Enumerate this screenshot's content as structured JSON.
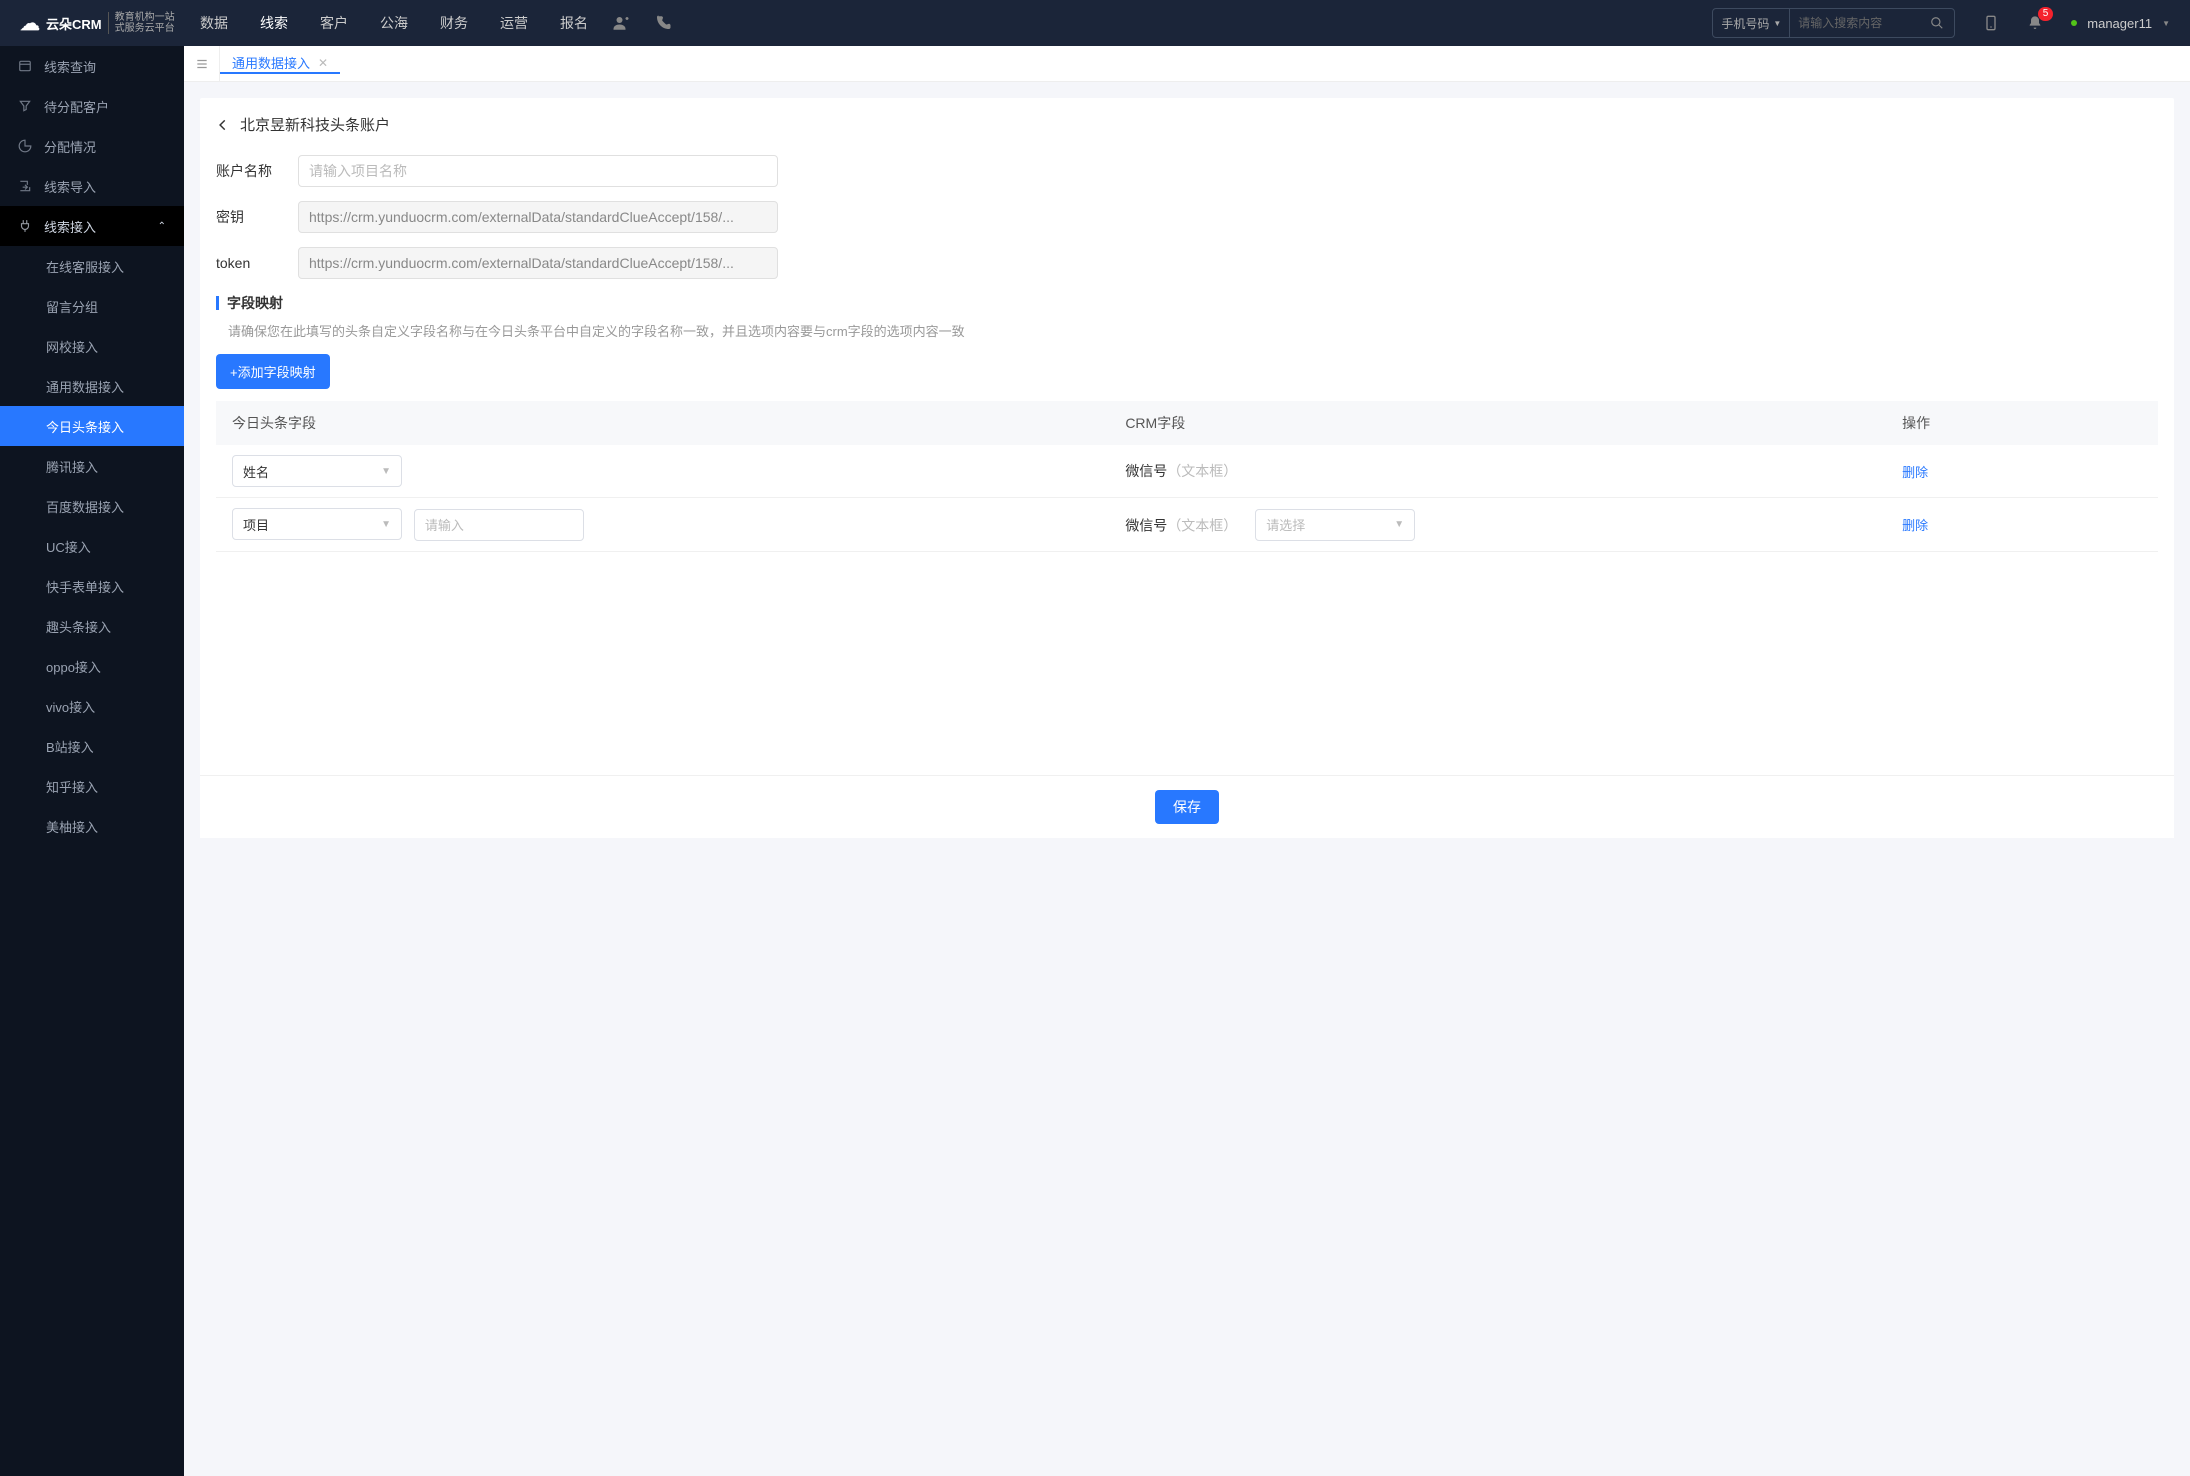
{
  "header": {
    "logo_brand": "云朵CRM",
    "logo_sub1": "教育机构一站",
    "logo_sub2": "式服务云平台",
    "nav": [
      "数据",
      "线索",
      "客户",
      "公海",
      "财务",
      "运营",
      "报名"
    ],
    "nav_active_index": 1,
    "search_type": "手机号码",
    "search_placeholder": "请输入搜索内容",
    "badge_count": "5",
    "username": "manager11"
  },
  "sidebar": {
    "items": [
      {
        "icon": "list",
        "label": "线索查询"
      },
      {
        "icon": "filter",
        "label": "待分配客户"
      },
      {
        "icon": "pie",
        "label": "分配情况"
      },
      {
        "icon": "import",
        "label": "线索导入"
      },
      {
        "icon": "plug",
        "label": "线索接入",
        "expanded": true
      }
    ],
    "sub_items": [
      "在线客服接入",
      "留言分组",
      "网校接入",
      "通用数据接入",
      "今日头条接入",
      "腾讯接入",
      "百度数据接入",
      "UC接入",
      "快手表单接入",
      "趣头条接入",
      "oppo接入",
      "vivo接入",
      "B站接入",
      "知乎接入",
      "美柚接入"
    ],
    "sub_active_index": 4
  },
  "tabs": {
    "items": [
      {
        "label": "通用数据接入",
        "closable": true
      }
    ],
    "active_index": 0
  },
  "page": {
    "title": "北京昱新科技头条账户",
    "form": {
      "account_label": "账户名称",
      "account_placeholder": "请输入项目名称",
      "account_value": "",
      "secret_label": "密钥",
      "secret_value": "https://crm.yunduocrm.com/externalData/standardClueAccept/158/...",
      "token_label": "token",
      "token_value": "https://crm.yunduocrm.com/externalData/standardClueAccept/158/..."
    },
    "mapping": {
      "title": "字段映射",
      "hint": "请确保您在此填写的头条自定义字段名称与在今日头条平台中自定义的字段名称一致，并且选项内容要与crm字段的选项内容一致",
      "add_label": "+添加字段映射",
      "cols": {
        "headline": "今日头条字段",
        "crm": "CRM字段",
        "op": "操作"
      },
      "rows": [
        {
          "headline_select": "姓名",
          "headline_input_show": false,
          "headline_input_placeholder": "",
          "crm_label": "微信号",
          "crm_hint": "（文本框）",
          "crm_select_show": false,
          "crm_select_placeholder": ""
        },
        {
          "headline_select": "项目",
          "headline_input_show": true,
          "headline_input_placeholder": "请输入",
          "crm_label": "微信号",
          "crm_hint": "（文本框）",
          "crm_select_show": true,
          "crm_select_placeholder": "请选择"
        }
      ],
      "delete_label": "删除"
    },
    "save_label": "保存"
  }
}
